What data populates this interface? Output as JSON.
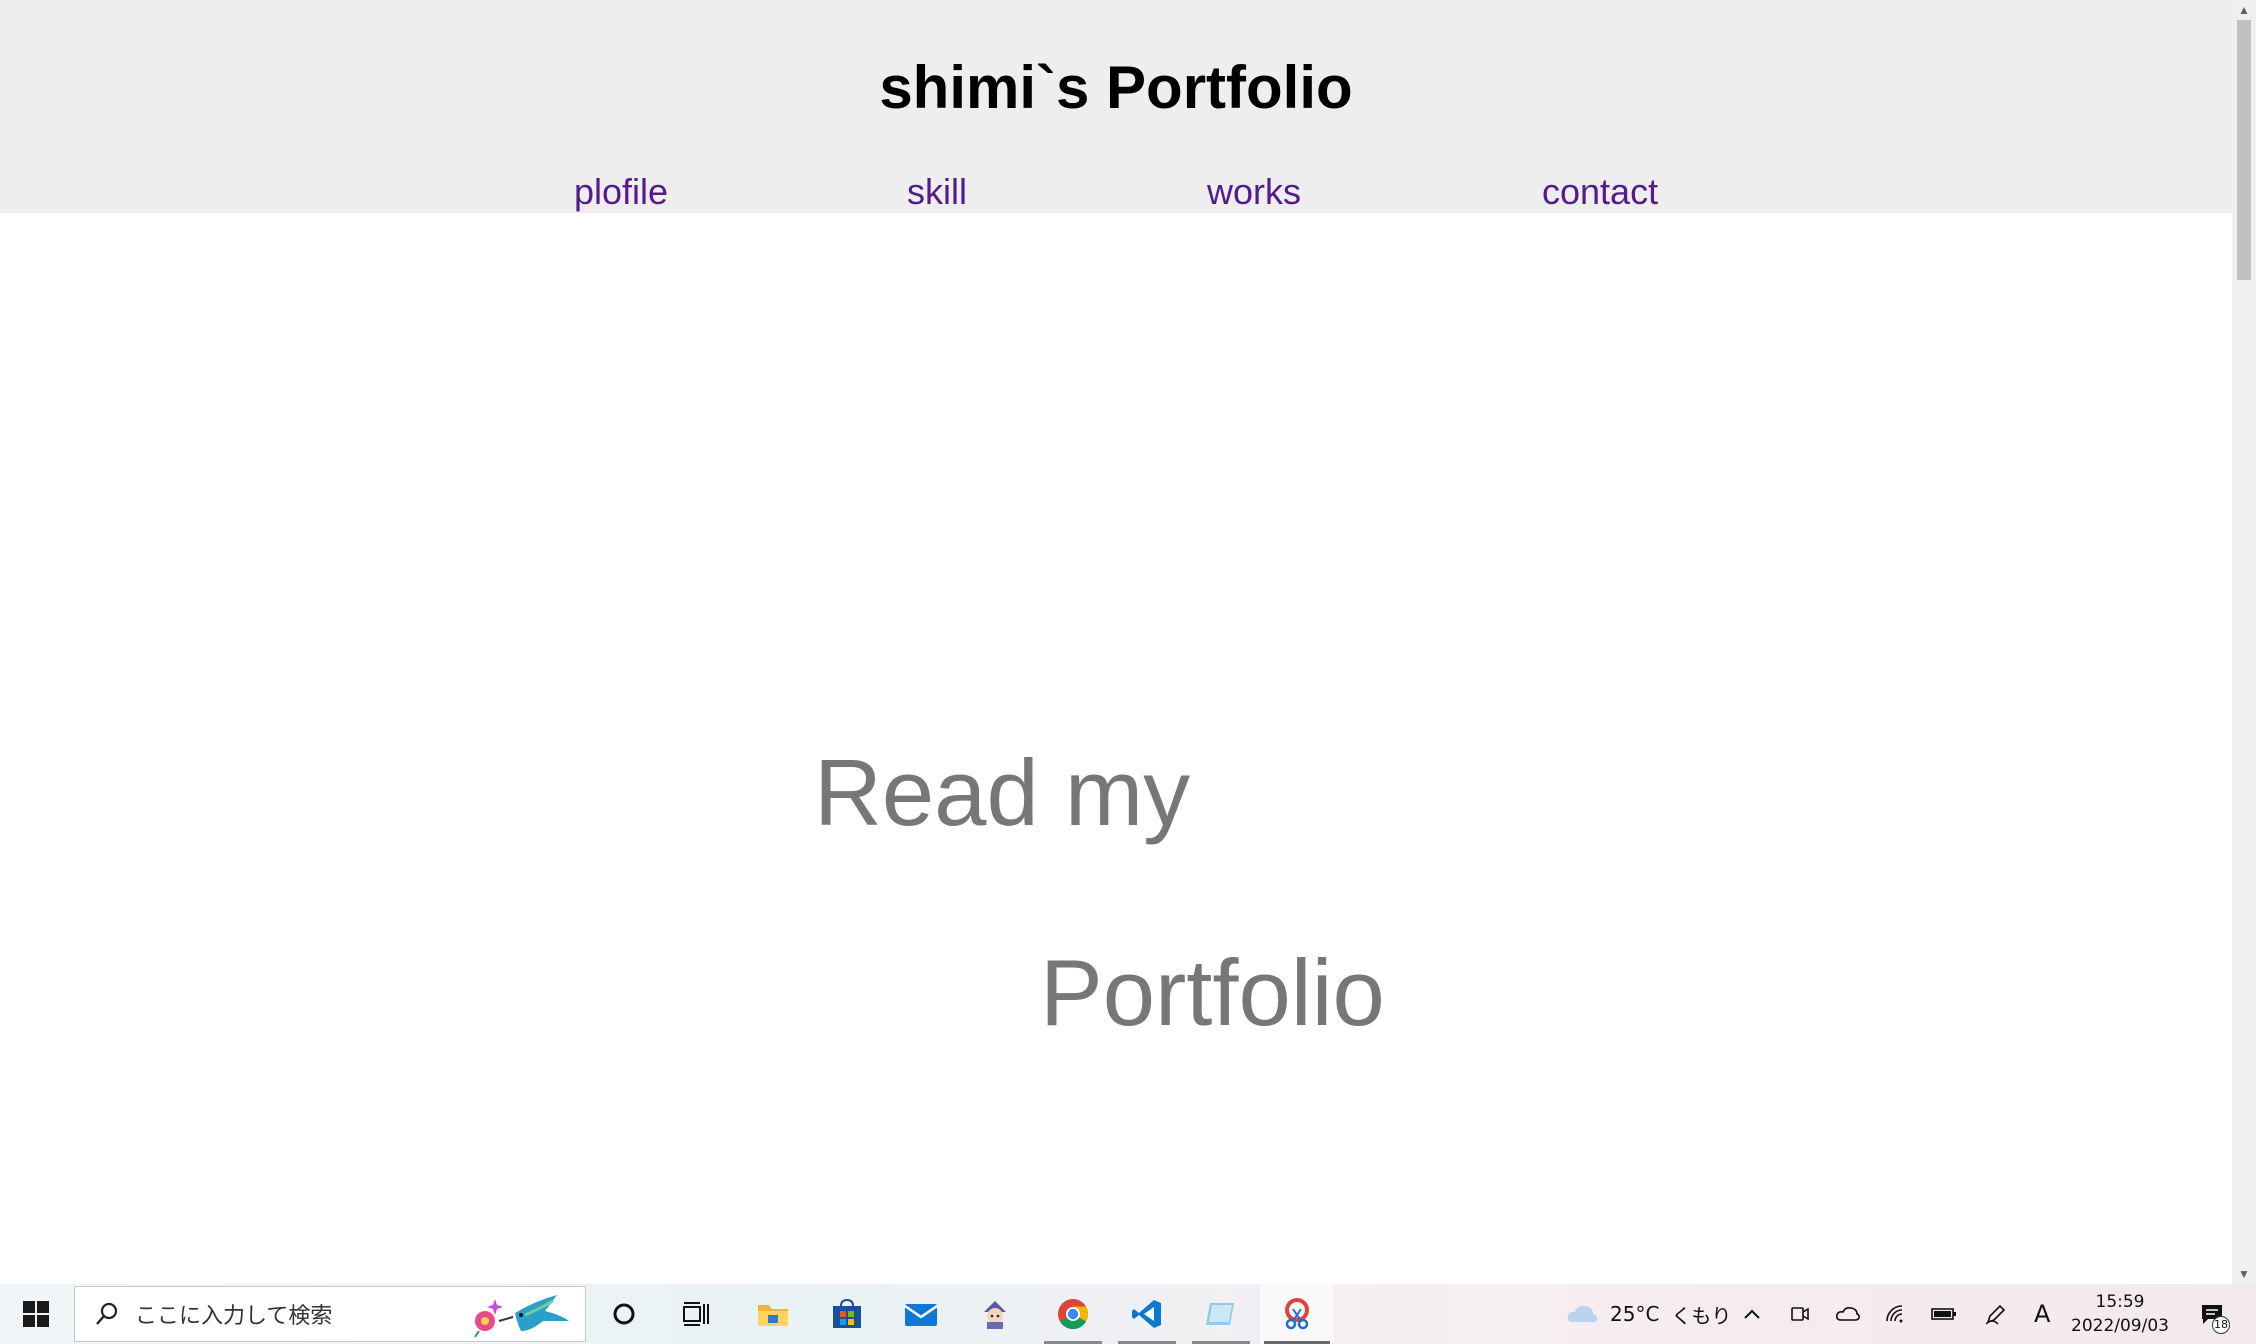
{
  "site": {
    "title": "shimi`s Portfolio",
    "nav": [
      "plofile",
      "skill",
      "works",
      "contact"
    ]
  },
  "hero": {
    "line1": "Read my",
    "line2": "Portfolio"
  },
  "taskbar": {
    "search_placeholder": "ここに入力して検索",
    "apps": [
      "task-view",
      "file-explorer",
      "microsoft-store",
      "mail",
      "game-app",
      "chrome",
      "vscode",
      "sticky-notes",
      "snipping-tool"
    ],
    "weather": {
      "temperature": "25°C",
      "condition": "くもり"
    },
    "ime_indicator": "A",
    "clock": {
      "time": "15:59",
      "date": "2022/09/03"
    },
    "notification_count": "18"
  },
  "colors": {
    "header_bg": "#eeeeee",
    "nav_link": "#551a8b",
    "hero_text": "#777777"
  }
}
